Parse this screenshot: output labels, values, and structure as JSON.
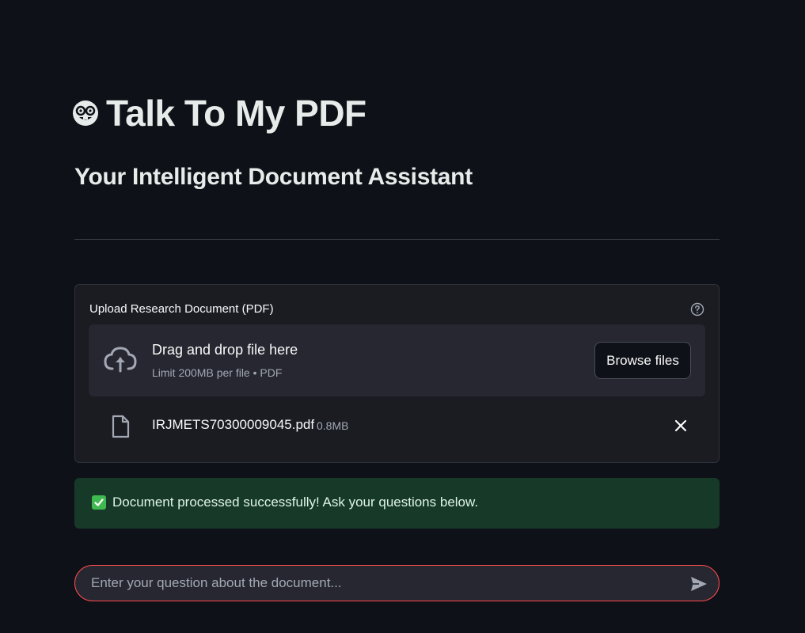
{
  "header": {
    "title": "Talk To My PDF",
    "title_emoji_icon": "nerd-face-icon",
    "subtitle": "Your Intelligent Document Assistant"
  },
  "uploader": {
    "label": "Upload Research Document (PDF)",
    "help_icon": "question-circle-icon",
    "dropzone_title": "Drag and drop file here",
    "dropzone_limit": "Limit 200MB per file • PDF",
    "browse_label": "Browse files",
    "uploaded_file": {
      "name": "IRJMETS70300009045.pdf",
      "size": "0.8MB"
    }
  },
  "status": {
    "message": "Document processed successfully! Ask your questions below.",
    "icon": "check-box-icon",
    "color": "#173928"
  },
  "chat": {
    "placeholder": "Enter your question about the document...",
    "value": "",
    "send_icon": "send-icon",
    "accent": "#ff4b4b"
  }
}
